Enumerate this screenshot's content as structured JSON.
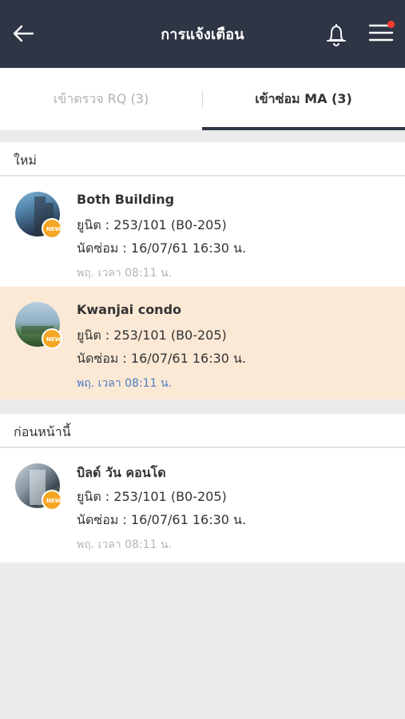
{
  "header": {
    "title": "การแจ้งเตือน",
    "back_icon": "arrow-left-icon",
    "bell_icon": "bell-icon",
    "menu_icon": "hamburger-menu-icon",
    "dot_color": "#ff3b30"
  },
  "tabs": [
    {
      "label": "เข้าตรวจ RQ (3)",
      "active": false
    },
    {
      "label": "เข้าซ่อม MA (3)",
      "active": true
    }
  ],
  "sections": [
    {
      "title": "ใหม่",
      "items": [
        {
          "name": "Both Building",
          "unit": "ยูนิต : 253/101 (B0-205)",
          "appointment": "นัดซ่อม : 16/07/61 16:30 น.",
          "time": "พฤ. เวลา 08:11 น.",
          "highlighted": false,
          "badge": "NEW"
        },
        {
          "name": "Kwanjai condo",
          "unit": "ยูนิต : 253/101 (B0-205)",
          "appointment": "นัดซ่อม : 16/07/61 16:30 น.",
          "time": "พฤ. เวลา 08:11 น.",
          "highlighted": true,
          "badge": "NEW"
        }
      ]
    },
    {
      "title": "ก่อนหน้านี้",
      "items": [
        {
          "name": "บิลด์ วัน คอนโด",
          "unit": "ยูนิต : 253/101 (B0-205)",
          "appointment": "นัดซ่อม : 16/07/61 16:30 น.",
          "time": "พฤ. เวลา 08:11 น.",
          "highlighted": false,
          "badge": "NEW"
        }
      ]
    }
  ],
  "colors": {
    "header_bg": "#2e3544",
    "highlight_bg": "#fbe9d6",
    "badge": "#f5a623",
    "highlight_time": "#4a7bbf"
  }
}
